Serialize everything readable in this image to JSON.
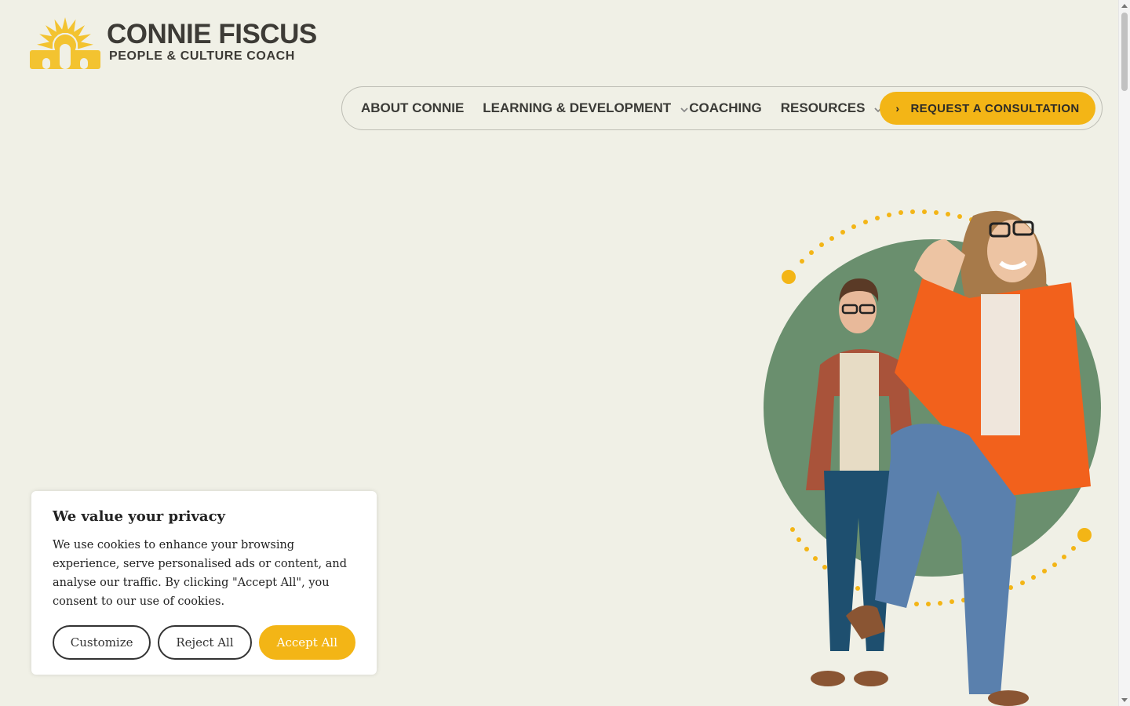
{
  "brand": {
    "name": "CONNIE FISCUS",
    "tagline": "PEOPLE & CULTURE COACH",
    "accent": "#f3b516",
    "logo_icon": "sunflower-logo"
  },
  "nav": {
    "items": [
      {
        "label": "ABOUT CONNIE",
        "has_dropdown": false
      },
      {
        "label": "LEARNING & DEVELOPMENT",
        "has_dropdown": true
      },
      {
        "label": "COACHING",
        "has_dropdown": false
      },
      {
        "label": "RESOURCES",
        "has_dropdown": true
      }
    ],
    "cta_label": "REQUEST A CONSULTATION",
    "cta_icon": "chevron-right-icon"
  },
  "hero": {
    "image_description_icon": "hero-people-illustration",
    "circle_color": "#6a8f6e",
    "dot_color": "#f3b516"
  },
  "cookie_banner": {
    "title": "We value your privacy",
    "body": "We use cookies to enhance your browsing experience, serve personalised ads or content, and analyse our traffic. By clicking \"Accept All\", you consent to our use of cookies.",
    "customize_label": "Customize",
    "reject_label": "Reject All",
    "accept_label": "Accept All"
  }
}
